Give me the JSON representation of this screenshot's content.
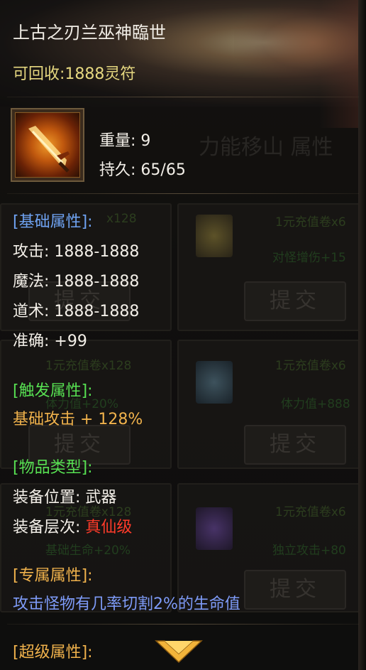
{
  "item": {
    "name": "上古之刃兰巫神臨世",
    "recycle": "可回收:1888灵符",
    "weight_label": "重量:",
    "weight_value": "9",
    "durability_label": "持久:",
    "durability_value": "65/65"
  },
  "basic": {
    "header": "[基础属性]:",
    "rows": [
      {
        "label": "攻击:",
        "value": "1888-1888"
      },
      {
        "label": "魔法:",
        "value": "1888-1888"
      },
      {
        "label": "道术:",
        "value": "1888-1888"
      },
      {
        "label": "准确:",
        "value": "+99"
      }
    ]
  },
  "trigger": {
    "header": "[触发属性]:",
    "text": "基础攻击 + 128%"
  },
  "type": {
    "header": "[物品类型]:",
    "position_label": "装备位置:",
    "position_value": "武器",
    "level_label": "装备层次:",
    "level_value": "真仙级"
  },
  "exclusive": {
    "header": "[专属属性]:",
    "text": "攻击怪物有几率切割2%的生命值"
  },
  "super": {
    "header": "[超级属性]:"
  },
  "background": {
    "header_text": "力能移山 属性",
    "cards": [
      {
        "left_text": "x128",
        "right_title": "1元充值卷x6",
        "right_text": "对怪增伤+15",
        "button": "提交"
      },
      {
        "left_title": "1元充值卷x128",
        "left_text": "体力值+20%",
        "right_title": "1元充值卷x6",
        "right_text": "体力值+888",
        "button": "提交"
      },
      {
        "left_title": "1元充值卷x128",
        "left_text": "基础生命+20%",
        "right_title": "1元充值卷x6",
        "right_text": "独立攻击+80",
        "button": "提交"
      }
    ]
  },
  "colors": {
    "header_blue": "#6fa3f2",
    "header_green": "#57e052",
    "trigger_orange": "#f0b24c",
    "rank_red": "#ff3b2a",
    "desc_blue": "#7e9bf8",
    "recycle_gold": "#e6d880"
  },
  "icons": {
    "item": "flaming-blade-icon",
    "scroll": "chevron-down-icon"
  }
}
